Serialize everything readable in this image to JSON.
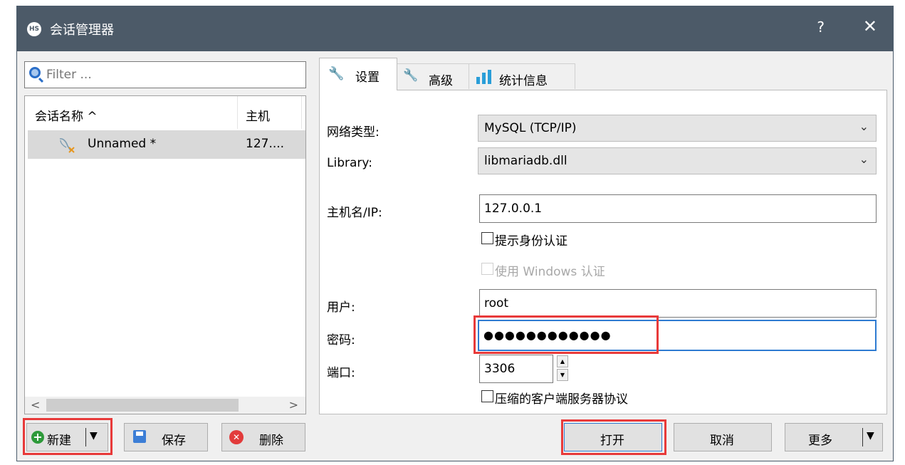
{
  "window": {
    "icon_text": "HS",
    "title": "会话管理器",
    "help": "?",
    "close": "✕"
  },
  "left": {
    "filter_placeholder": "Filter ...",
    "columns": {
      "name": "会话名称 ^",
      "host": "主机"
    },
    "sessions": [
      {
        "name": "Unnamed *",
        "host": "127...."
      }
    ],
    "scroll_left": "<",
    "scroll_right": ">"
  },
  "tabs": [
    {
      "label": "设置",
      "icon": "wrench-icon",
      "active": true
    },
    {
      "label": "高级",
      "icon": "wrench-orange-icon",
      "active": false
    },
    {
      "label": "统计信息",
      "icon": "bar-chart-icon",
      "active": false
    }
  ],
  "settings": {
    "network_type_label": "网络类型:",
    "network_type_value": "MySQL (TCP/IP)",
    "library_label": "Library:",
    "library_value": "libmariadb.dll",
    "host_label": "主机名/IP:",
    "host_value": "127.0.0.1",
    "prompt_auth_label": "提示身份认证",
    "windows_auth_label": "使用 Windows 认证",
    "user_label": "用户:",
    "user_value": "root",
    "password_label": "密码:",
    "password_value": "●●●●●●●●●●●●",
    "port_label": "端口:",
    "port_value": "3306",
    "compress_label": "压缩的客户端服务器协议"
  },
  "buttons": {
    "new": "新建",
    "save": "保存",
    "delete": "删除",
    "open": "打开",
    "cancel": "取消",
    "more": "更多"
  },
  "colors": {
    "highlight": "#e83a3a",
    "titlebar": "#4c5a68",
    "focus": "#2e7bd1"
  }
}
